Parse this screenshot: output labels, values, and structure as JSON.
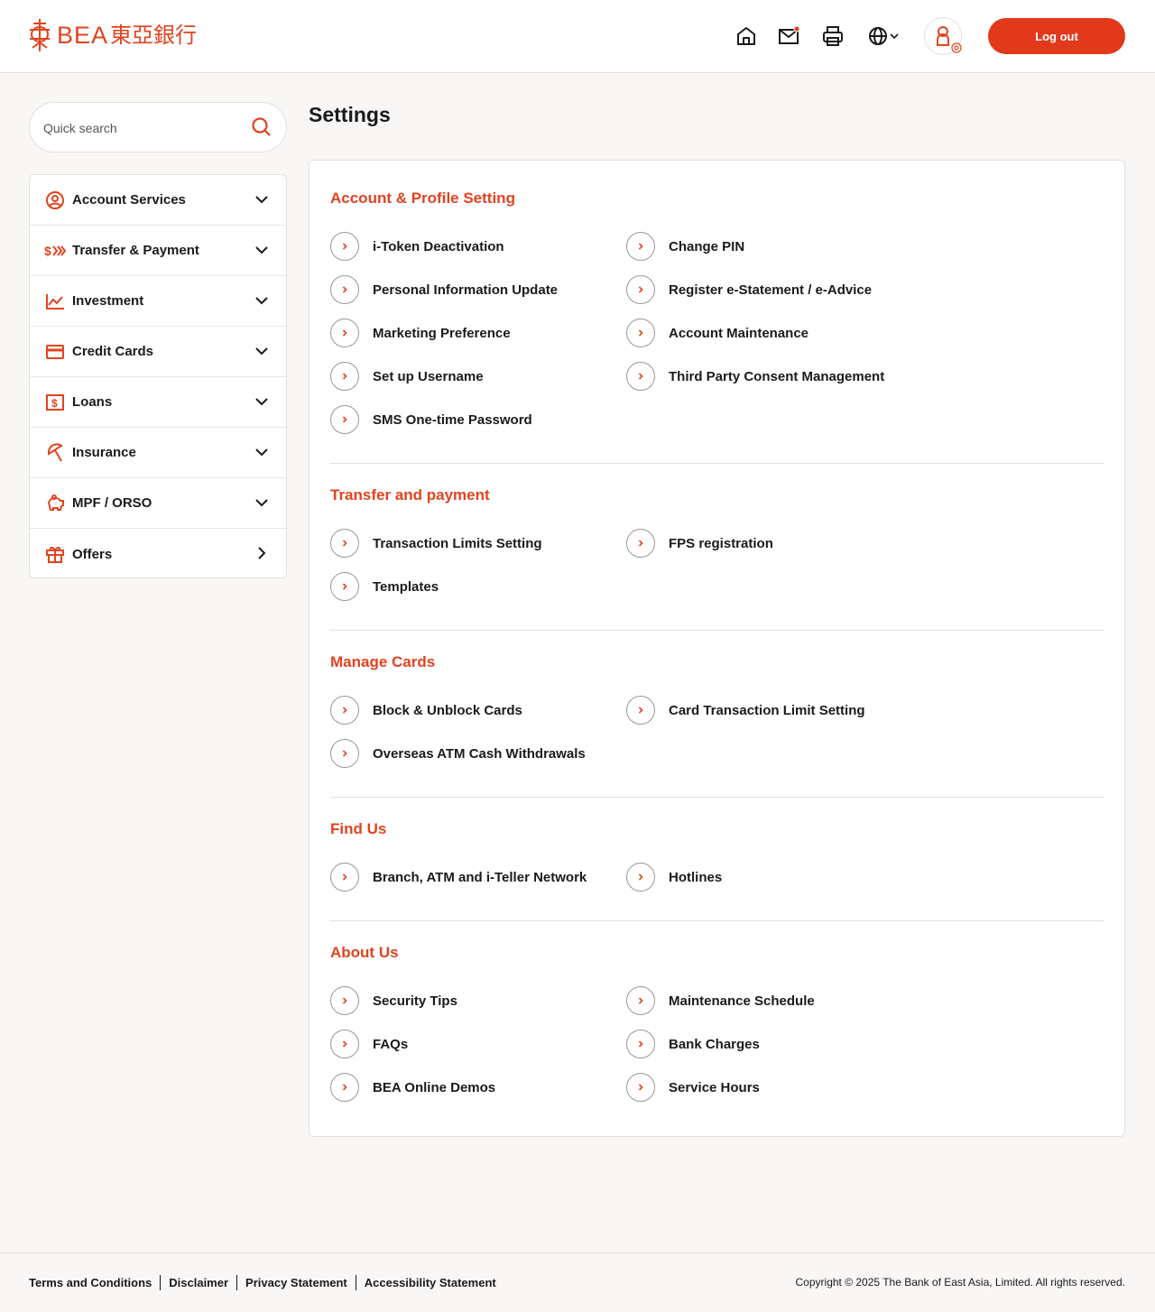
{
  "brand": {
    "name": "BEA",
    "name_cjk": "東亞銀行",
    "accent": "#e2431f",
    "button_color": "#e2391a"
  },
  "header": {
    "icons": [
      "home-icon",
      "mail-icon",
      "print-icon",
      "globe-icon",
      "user-icon"
    ],
    "logout_label": "Log out"
  },
  "search": {
    "placeholder": "Quick search"
  },
  "sidebar": {
    "items": [
      {
        "label": "Account Services",
        "icon": "account-icon"
      },
      {
        "label": "Transfer & Payment",
        "icon": "transfer-icon"
      },
      {
        "label": "Investment",
        "icon": "investment-icon"
      },
      {
        "label": "Credit Cards",
        "icon": "credit-card-icon"
      },
      {
        "label": "Loans",
        "icon": "loan-icon"
      },
      {
        "label": "Insurance",
        "icon": "umbrella-icon"
      },
      {
        "label": "MPF / ORSO",
        "icon": "piggy-bank-icon"
      },
      {
        "label": "Offers",
        "icon": "gift-icon"
      }
    ]
  },
  "page": {
    "title": "Settings"
  },
  "sections": [
    {
      "title": "Account & Profile Setting",
      "links": [
        "i-Token Deactivation",
        "Change PIN",
        "Personal Information Update",
        "Register e-Statement / e-Advice",
        "Marketing Preference",
        "Account Maintenance",
        "Set up Username",
        "Third Party Consent Management",
        "SMS One-time Password"
      ]
    },
    {
      "title": "Transfer and payment",
      "links": [
        "Transaction Limits Setting",
        "FPS registration",
        "Templates"
      ]
    },
    {
      "title": "Manage Cards",
      "links": [
        "Block & Unblock Cards",
        "Card Transaction Limit Setting",
        "Overseas ATM Cash Withdrawals"
      ]
    },
    {
      "title": "Find Us",
      "links": [
        "Branch, ATM and i-Teller Network",
        "Hotlines"
      ]
    },
    {
      "title": "About Us",
      "links": [
        "Security Tips",
        "Maintenance Schedule",
        "FAQs",
        "Bank Charges",
        "BEA Online Demos",
        "Service Hours"
      ]
    }
  ],
  "footer": {
    "links": [
      "Terms and Conditions",
      "Disclaimer",
      "Privacy Statement",
      "Accessibility Statement"
    ],
    "copyright": "Copyright © 2025 The Bank of East Asia, Limited. All rights reserved."
  }
}
